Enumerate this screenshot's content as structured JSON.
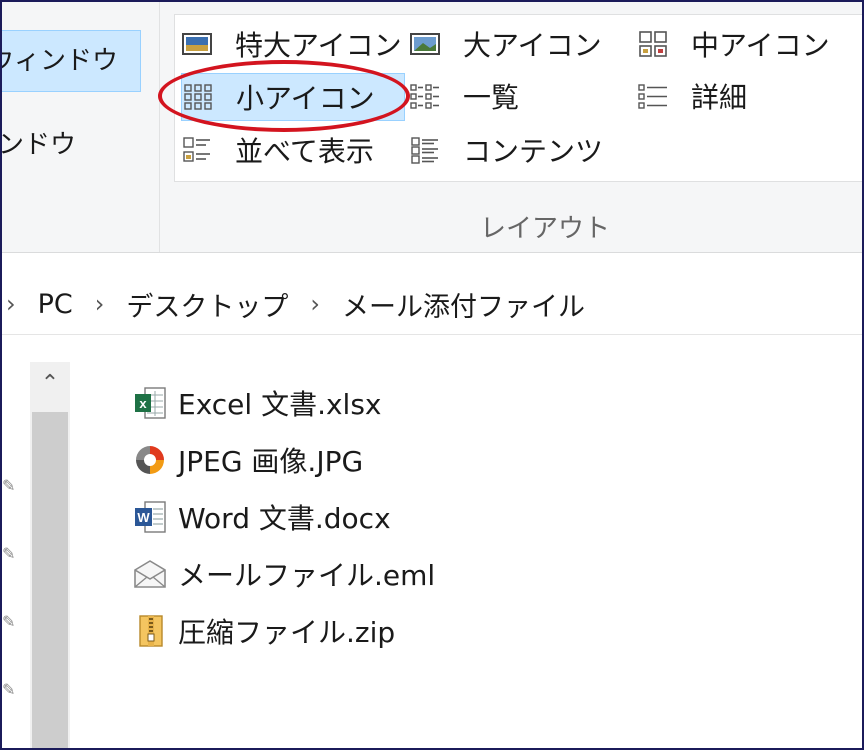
{
  "ribbon": {
    "pane_buttons": [
      "ウィンドウ",
      "ンドウ"
    ],
    "layout_items": [
      {
        "label": "特大アイコン",
        "icon": "extra-large-icons-icon",
        "selected": false
      },
      {
        "label": "大アイコン",
        "icon": "large-icons-icon",
        "selected": false
      },
      {
        "label": "中アイコン",
        "icon": "medium-icons-icon",
        "selected": false
      },
      {
        "label": "小アイコン",
        "icon": "small-icons-icon",
        "selected": true
      },
      {
        "label": "一覧",
        "icon": "list-icon",
        "selected": false
      },
      {
        "label": "詳細",
        "icon": "details-icon",
        "selected": false
      },
      {
        "label": "並べて表示",
        "icon": "tiles-icon",
        "selected": false
      },
      {
        "label": "コンテンツ",
        "icon": "content-icon",
        "selected": false
      }
    ],
    "group_label": "レイアウト",
    "highlight_color": "#d3141f",
    "selected_color": "#cce8ff"
  },
  "address": {
    "crumbs": [
      "PC",
      "デスクトップ",
      "メール添付ファイル"
    ]
  },
  "files": [
    {
      "name": "Excel 文書.xlsx",
      "icon": "excel-file-icon"
    },
    {
      "name": "JPEG 画像.JPG",
      "icon": "image-file-icon"
    },
    {
      "name": "Word 文書.docx",
      "icon": "word-file-icon"
    },
    {
      "name": "メールファイル.eml",
      "icon": "mail-file-icon"
    },
    {
      "name": "圧縮ファイル.zip",
      "icon": "zip-file-icon"
    }
  ]
}
